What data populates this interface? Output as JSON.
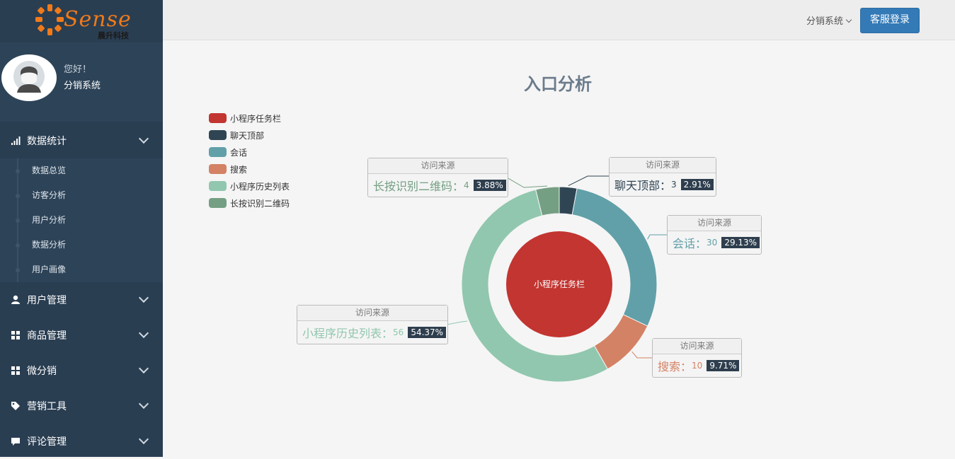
{
  "logo": {
    "brand": "Sense",
    "subtitle": "晨升科技"
  },
  "profile": {
    "greeting": "您好！",
    "name": "分销系统"
  },
  "sidebar": {
    "sections": [
      {
        "label": "数据统计",
        "icon": "bar-chart-icon"
      },
      {
        "label": "用户管理",
        "icon": "user-icon"
      },
      {
        "label": "商品管理",
        "icon": "grid-icon"
      },
      {
        "label": "微分销",
        "icon": "grid-icon"
      },
      {
        "label": "营销工具",
        "icon": "tags-icon"
      },
      {
        "label": "评论管理",
        "icon": "comment-icon"
      }
    ],
    "sub_items": [
      "数据总览",
      "访客分析",
      "用户分析",
      "数据分析",
      "用户画像"
    ]
  },
  "header": {
    "dropdown_label": "分销系统",
    "button_label": "客服登录"
  },
  "chart_data": {
    "type": "pie",
    "title": "入口分析",
    "tooltip_title": "访问来源",
    "center_label": "小程序任务栏",
    "legend": [
      "小程序任务栏",
      "聊天顶部",
      "会话",
      "搜索",
      "小程序历史列表",
      "长按识别二维码"
    ],
    "colors": [
      "#c23531",
      "#2f4554",
      "#61a0a8",
      "#d48265",
      "#91c7ae",
      "#749f83"
    ],
    "inner": {
      "name": "小程序任务栏"
    },
    "outer": [
      {
        "name": "聊天顶部",
        "value": 3,
        "percent": "2.91%"
      },
      {
        "name": "会话",
        "value": 30,
        "percent": "29.13%"
      },
      {
        "name": "搜索",
        "value": 10,
        "percent": "9.71%"
      },
      {
        "name": "小程序历史列表",
        "value": 56,
        "percent": "54.37%"
      },
      {
        "name": "长按识别二维码",
        "value": 4,
        "percent": "3.88%"
      }
    ]
  }
}
